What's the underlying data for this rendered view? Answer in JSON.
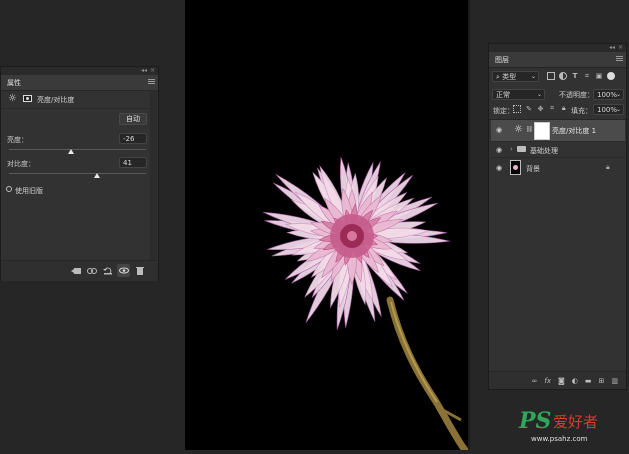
{
  "properties_panel": {
    "tab": "属性",
    "adjustment_title": "亮度/对比度",
    "auto_button": "自动",
    "brightness_label": "亮度：",
    "brightness_value": "-26",
    "brightness_level": 0.45,
    "contrast_label": "对比度：",
    "contrast_value": "41",
    "contrast_level": 0.64,
    "legacy_label": "使用旧版",
    "collapse_glyph": "◂◂",
    "close_glyph": "×"
  },
  "layers_panel": {
    "tab": "图层",
    "filter_kind": "类型",
    "blend_mode": "正常",
    "opacity_label": "不透明度：",
    "opacity_value": "100%",
    "lock_label": "锁定：",
    "fill_label": "填充：",
    "fill_value": "100%",
    "collapse_glyph": "◂◂",
    "close_glyph": "×",
    "layers": [
      {
        "name": "亮度/对比度 1",
        "type": "adjustment"
      },
      {
        "name": "基础处理",
        "type": "group"
      },
      {
        "name": "背景",
        "type": "image",
        "locked": true
      }
    ]
  },
  "watermark": {
    "brand": "PS",
    "chinese": "爱好者",
    "url": "www.psahz.com"
  },
  "colors": {
    "app_bg": "#262626",
    "panel_bg": "#323232",
    "selected_row": "#4b4b4b",
    "flower_pink": "#e7b3d0",
    "flower_purple": "#9a4f9c",
    "stem": "#8c7336",
    "watermark_green": "#2fa65a"
  }
}
